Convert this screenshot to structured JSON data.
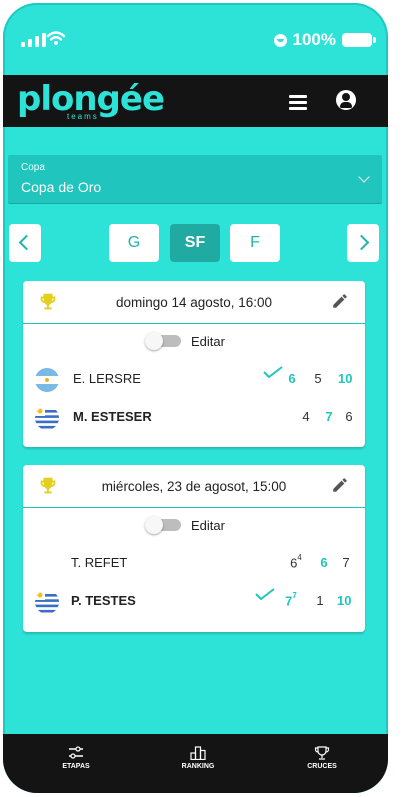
{
  "status": {
    "battery_text": "100%"
  },
  "header": {
    "logo_main": "plongée",
    "logo_sub": "teams"
  },
  "select": {
    "label": "Copa",
    "value": "Copa de Oro"
  },
  "stages": {
    "items": [
      "G",
      "SF",
      "F"
    ],
    "active": "SF"
  },
  "matches": [
    {
      "date": "domingo 14 agosto,   16:00",
      "edit_label": "Editar",
      "players": [
        {
          "name": "E. LERSRE",
          "flag": "argentina",
          "winner": false,
          "scores": [
            "6",
            "5",
            "10"
          ]
        },
        {
          "name": "M. ESTESER",
          "flag": "uruguay",
          "winner": true,
          "scores": [
            "4",
            "7",
            "6"
          ]
        }
      ]
    },
    {
      "date": "miércoles, 23 de agosot,  15:00",
      "edit_label": "Editar",
      "players": [
        {
          "name": "T. REFET",
          "flag": "",
          "winner": false,
          "scores": [
            "6",
            "6",
            "7"
          ],
          "tiebreak": "4"
        },
        {
          "name": "P. TESTES",
          "flag": "uruguay",
          "winner": true,
          "scores": [
            "7",
            "1",
            "10"
          ],
          "tiebreak": "7"
        }
      ]
    }
  ],
  "bottom_nav": [
    {
      "label": "ETAPAS",
      "icon": "sliders-icon"
    },
    {
      "label": "RANKING",
      "icon": "podium-icon"
    },
    {
      "label": "CRUCES",
      "icon": "trophy-icon"
    }
  ],
  "colors": {
    "accent": "#2de3d8",
    "accent_dark": "#20aaa2",
    "header": "#141414"
  }
}
